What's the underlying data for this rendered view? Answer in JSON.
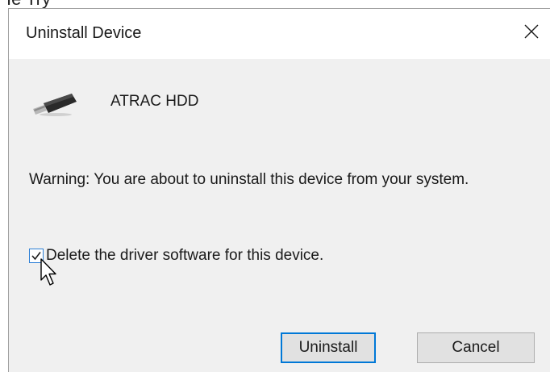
{
  "background_partial_text": "Ie Try",
  "dialog": {
    "title": "Uninstall Device",
    "close_label": "×"
  },
  "device": {
    "name": "ATRAC HDD",
    "icon": "usb-drive-icon"
  },
  "warning_text": "Warning: You are about to uninstall this device from your system.",
  "checkbox": {
    "label": "Delete the driver software for this device.",
    "checked": true
  },
  "buttons": {
    "uninstall_label": "Uninstall",
    "cancel_label": "Cancel"
  },
  "colors": {
    "accent": "#0078d7",
    "client_bg": "#f0f0f0",
    "button_bg": "#e1e1e1"
  }
}
